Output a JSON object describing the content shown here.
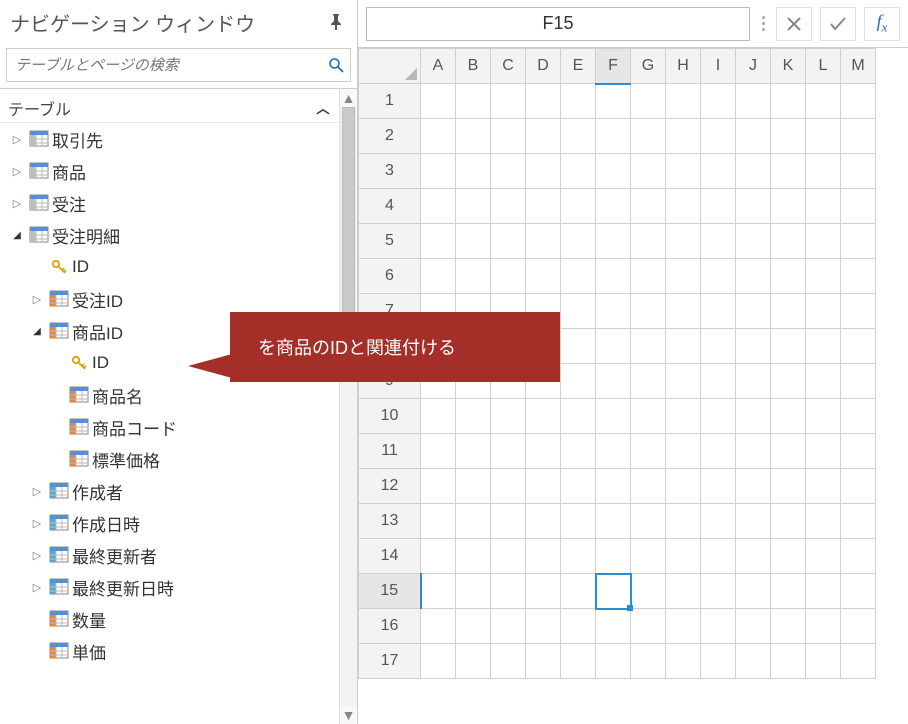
{
  "nav": {
    "title": "ナビゲーション ウィンドウ",
    "search_placeholder": "テーブルとページの検索",
    "section_label": "テーブル",
    "items": [
      {
        "label": "取引先",
        "icon": "table",
        "expanded": false,
        "indent": 1
      },
      {
        "label": "商品",
        "icon": "table",
        "expanded": false,
        "indent": 1
      },
      {
        "label": "受注",
        "icon": "table",
        "expanded": false,
        "indent": 1
      },
      {
        "label": "受注明細",
        "icon": "table",
        "expanded": true,
        "indent": 1
      },
      {
        "label": "ID",
        "icon": "key",
        "indent": 2
      },
      {
        "label": "受注ID",
        "icon": "table-col",
        "expanded": false,
        "indent": 2
      },
      {
        "label": "商品ID",
        "icon": "table-col",
        "expanded": true,
        "indent": 2
      },
      {
        "label": "ID",
        "icon": "key",
        "indent": 3
      },
      {
        "label": "商品名",
        "icon": "table-col",
        "indent": 3
      },
      {
        "label": "商品コード",
        "icon": "table-col",
        "indent": 3
      },
      {
        "label": "標準価格",
        "icon": "table-col",
        "indent": 3
      },
      {
        "label": "作成者",
        "icon": "table-date",
        "expanded": false,
        "indent": 2
      },
      {
        "label": "作成日時",
        "icon": "table-date",
        "expanded": false,
        "indent": 2
      },
      {
        "label": "最終更新者",
        "icon": "table-date",
        "expanded": false,
        "indent": 2
      },
      {
        "label": "最終更新日時",
        "icon": "table-date",
        "expanded": false,
        "indent": 2
      },
      {
        "label": "数量",
        "icon": "table-col",
        "indent": 2
      },
      {
        "label": "単価",
        "icon": "table-col",
        "indent": 2
      }
    ]
  },
  "sheet": {
    "name_box": "F15",
    "columns": [
      "A",
      "B",
      "C",
      "D",
      "E",
      "F",
      "G",
      "H",
      "I",
      "J",
      "K",
      "L",
      "M"
    ],
    "rows": [
      1,
      2,
      3,
      4,
      5,
      6,
      7,
      8,
      9,
      10,
      11,
      12,
      13,
      14,
      15,
      16,
      17
    ],
    "selected_col": "F",
    "selected_row": 15
  },
  "callout": {
    "text": "を商品のIDと関連付ける"
  },
  "icons": {
    "pin": "pin-icon",
    "search": "search-icon",
    "cancel": "close-icon",
    "confirm": "check-icon",
    "fx": "fx-icon"
  }
}
